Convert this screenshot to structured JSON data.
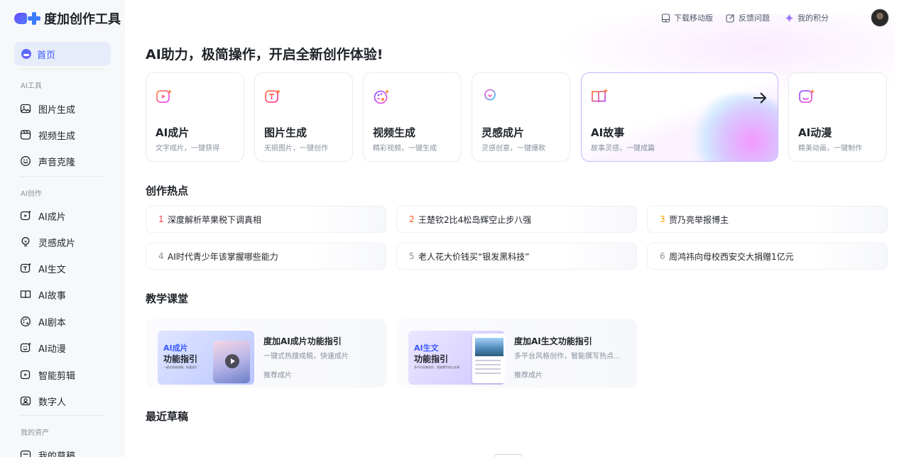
{
  "brand": {
    "name": "度加创作工具"
  },
  "topbar": {
    "download": "下载移动版",
    "feedback": "反馈问题",
    "points": "我的积分"
  },
  "sidebar": {
    "home": "首页",
    "sections": [
      {
        "label": "AI工具",
        "items": [
          "图片生成",
          "视频生成",
          "声音克隆"
        ]
      },
      {
        "label": "AI创作",
        "items": [
          "AI成片",
          "灵感成片",
          "AI生文",
          "AI故事",
          "AI剧本",
          "AI动漫",
          "智能剪辑",
          "数字人"
        ]
      },
      {
        "label": "我的资产",
        "items": [
          "我的草稿"
        ]
      }
    ]
  },
  "headline": "AI助力，极简操作，开启全新创作体验!",
  "feature_cards": [
    {
      "title": "AI成片",
      "subtitle": "文字成片，一键获得",
      "icon": "video-sparkle-icon"
    },
    {
      "title": "图片生成",
      "subtitle": "无损图片，一键创作",
      "icon": "image-text-icon"
    },
    {
      "title": "视频生成",
      "subtitle": "精彩视频，一键生成",
      "icon": "palette-icon"
    },
    {
      "title": "灵感成片",
      "subtitle": "灵感创意，一键爆款",
      "icon": "lightbulb-icon"
    },
    {
      "title": "AI故事",
      "subtitle": "故事灵感，一键成篇",
      "icon": "book-icon"
    },
    {
      "title": "AI动漫",
      "subtitle": "精美动画，一键制作",
      "icon": "smile-face-icon"
    }
  ],
  "hot": {
    "title": "创作热点",
    "items": [
      {
        "rank": "1",
        "text": "深度解析苹果税下调真相",
        "color": "#f53f3f"
      },
      {
        "rank": "2",
        "text": "王楚钦2比4松岛辉空止步八强",
        "color": "#ff5a1f"
      },
      {
        "rank": "3",
        "text": "贾乃亮举报博主",
        "color": "#ffa200"
      },
      {
        "rank": "4",
        "text": "AI时代青少年该掌握哪些能力",
        "color": "#86909c"
      },
      {
        "rank": "5",
        "text": "老人花大价钱买“银发黑科技”",
        "color": "#86909c"
      },
      {
        "rank": "6",
        "text": "周鸿祎向母校西安交大捐赠1亿元",
        "color": "#86909c"
      }
    ]
  },
  "tutorials": {
    "title": "教学课堂",
    "items": [
      {
        "title": "度加AI成片功能指引",
        "desc": "一键式热搜成稿，快速成片",
        "tag": "推荐成片",
        "thumb_k1": "AI成片",
        "thumb_k2": "功能指引",
        "thumb_k3": "一键式热搜成稿，快速成片"
      },
      {
        "title": "度加AI生文功能指引",
        "desc": "多平台风格创作，智能撰写热点...",
        "tag": "推荐成片",
        "thumb_k1": "AI生文",
        "thumb_k2": "功能指引",
        "thumb_k3": "多平台风格创作，智能撰写热点文章"
      }
    ]
  },
  "drafts": {
    "title": "最近草稿"
  },
  "colors": {
    "accent": "#3d5afe",
    "active_border": "#c6b6ff"
  }
}
